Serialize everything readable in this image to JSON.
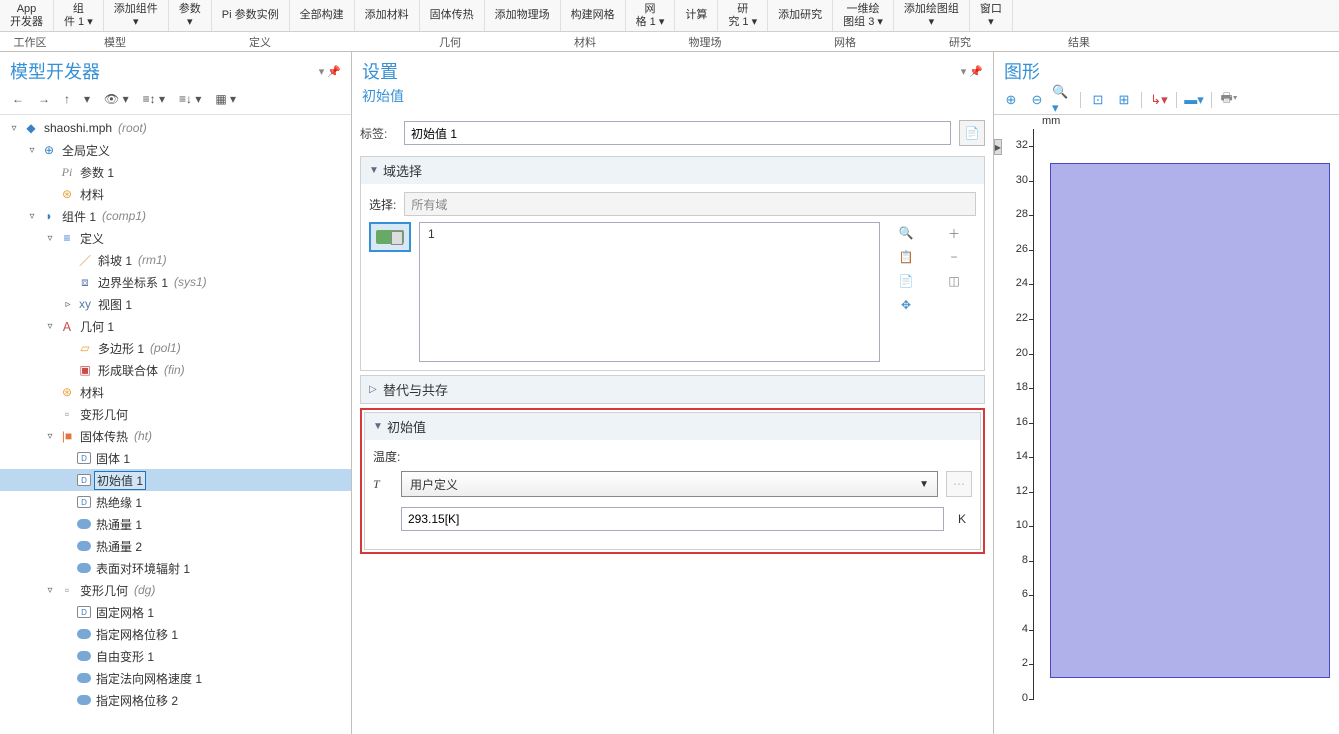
{
  "ribbon": {
    "items": [
      {
        "l1": "App",
        "l2": "开发器"
      },
      {
        "l1": "组",
        "l2": "件 1 ▾"
      },
      {
        "l1": "添加组件",
        "l2": "▾"
      },
      {
        "l1": "参数",
        "l2": "▾"
      },
      {
        "l1": "Pi  参数实例",
        "l2": ""
      },
      {
        "l1": "全部构建",
        "l2": ""
      },
      {
        "l1": "添加材料",
        "l2": ""
      },
      {
        "l1": "固体传热",
        "l2": ""
      },
      {
        "l1": "添加物理场",
        "l2": ""
      },
      {
        "l1": "构建网格",
        "l2": ""
      },
      {
        "l1": "网",
        "l2": "格 1 ▾"
      },
      {
        "l1": "计算",
        "l2": ""
      },
      {
        "l1": "研",
        "l2": "究 1 ▾"
      },
      {
        "l1": "添加研究",
        "l2": ""
      },
      {
        "l1": "一维绘",
        "l2": "图组 3 ▾"
      },
      {
        "l1": "添加绘图组",
        "l2": "▾"
      },
      {
        "l1": "窗口",
        "l2": "▾"
      }
    ],
    "groups": [
      "工作区",
      "模型",
      "定义",
      "几何",
      "材料",
      "物理场",
      "网格",
      "研究",
      "结果",
      ""
    ]
  },
  "left": {
    "title": "模型开发器",
    "toolbar": [
      "←",
      "→",
      "↑",
      "▾",
      "👁 ▾",
      "≡↕ ▾",
      "≡↓ ▾",
      "▦ ▾"
    ],
    "tree": [
      {
        "d": 0,
        "a": "▿",
        "i": "ico-root",
        "g": "◆",
        "t": "shaoshi.mph",
        "tag": "(root)"
      },
      {
        "d": 1,
        "a": "▿",
        "i": "ico-globe",
        "g": "⊕",
        "t": "全局定义"
      },
      {
        "d": 2,
        "a": "",
        "i": "ico-pi",
        "g": "Pi",
        "t": "参数 1"
      },
      {
        "d": 2,
        "a": "",
        "i": "ico-mat",
        "g": "⊛",
        "t": "材料"
      },
      {
        "d": 1,
        "a": "▿",
        "i": "ico-comp",
        "g": "◗",
        "t": "组件 1",
        "tag": "(comp1)"
      },
      {
        "d": 2,
        "a": "▿",
        "i": "ico-def",
        "g": "≡",
        "t": "定义"
      },
      {
        "d": 3,
        "a": "",
        "i": "ico-ramp",
        "g": "／",
        "t": "斜坡 1",
        "tag": "(rm1)"
      },
      {
        "d": 3,
        "a": "",
        "i": "ico-sys",
        "g": "⧈",
        "t": "边界坐标系 1",
        "tag": "(sys1)"
      },
      {
        "d": 3,
        "a": "▹",
        "i": "ico-view",
        "g": "xy",
        "t": "视图 1"
      },
      {
        "d": 2,
        "a": "▿",
        "i": "ico-geom",
        "g": "Ａ",
        "t": "几何 1"
      },
      {
        "d": 3,
        "a": "",
        "i": "ico-poly",
        "g": "▱",
        "t": "多边形 1",
        "tag": "(pol1)"
      },
      {
        "d": 3,
        "a": "",
        "i": "ico-union",
        "g": "▣",
        "t": "形成联合体",
        "tag": "(fin)"
      },
      {
        "d": 2,
        "a": "",
        "i": "ico-mat2",
        "g": "⊛",
        "t": "材料"
      },
      {
        "d": 2,
        "a": "",
        "i": "ico-deform",
        "g": "▫",
        "t": "变形几何"
      },
      {
        "d": 2,
        "a": "▿",
        "i": "ico-ht",
        "g": "|■",
        "t": "固体传热",
        "tag": "(ht)"
      },
      {
        "d": 3,
        "a": "",
        "i": "ico-d",
        "g": "D",
        "t": "固体 1"
      },
      {
        "d": 3,
        "a": "",
        "i": "ico-d",
        "g": "D",
        "t": "初始值 1",
        "sel": true
      },
      {
        "d": 3,
        "a": "",
        "i": "ico-d",
        "g": "D",
        "t": "热绝缘 1"
      },
      {
        "d": 3,
        "a": "",
        "i": "ico-flux",
        "g": "",
        "t": "热通量 1"
      },
      {
        "d": 3,
        "a": "",
        "i": "ico-flux",
        "g": "",
        "t": "热通量 2"
      },
      {
        "d": 3,
        "a": "",
        "i": "ico-flux",
        "g": "",
        "t": "表面对环境辐射 1"
      },
      {
        "d": 2,
        "a": "▿",
        "i": "ico-deform",
        "g": "▫",
        "t": "变形几何",
        "tag": "(dg)"
      },
      {
        "d": 3,
        "a": "",
        "i": "ico-d",
        "g": "D",
        "t": "固定网格 1"
      },
      {
        "d": 3,
        "a": "",
        "i": "ico-flux",
        "g": "",
        "t": "指定网格位移 1"
      },
      {
        "d": 3,
        "a": "",
        "i": "ico-flux",
        "g": "",
        "t": "自由变形 1"
      },
      {
        "d": 3,
        "a": "",
        "i": "ico-flux",
        "g": "",
        "t": "指定法向网格速度 1"
      },
      {
        "d": 3,
        "a": "",
        "i": "ico-flux",
        "g": "",
        "t": "指定网格位移 2"
      }
    ]
  },
  "mid": {
    "title": "设置",
    "subtitle": "初始值",
    "label_tag": "标签:",
    "tag_value": "初始值 1",
    "sec_domain": "域选择",
    "sel_label": "选择:",
    "sel_value": "所有域",
    "domain_item": "1",
    "sec_override": "替代与共存",
    "sec_init": "初始值",
    "temp_label": "温度:",
    "t_symbol": "T",
    "t_mode": "用户定义",
    "t_value": "293.15[K]",
    "t_unit": "K"
  },
  "right": {
    "title": "图形",
    "unit": "mm",
    "yticks": [
      32,
      30,
      28,
      26,
      24,
      22,
      20,
      18,
      16,
      14,
      12,
      10,
      8,
      6,
      4,
      2,
      0
    ]
  }
}
